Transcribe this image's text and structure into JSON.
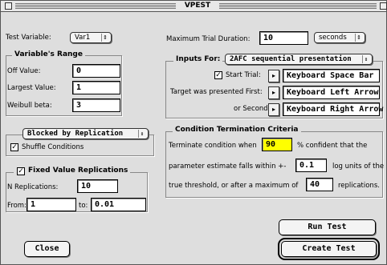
{
  "window": {
    "title": "VPEST"
  },
  "test_variable": {
    "label": "Test Variable:",
    "value": "Var1"
  },
  "variable_range": {
    "title": "Variable's Range",
    "off_value_label": "Off Value:",
    "off_value": "0",
    "largest_value_label": "Largest Value:",
    "largest_value": "1",
    "weibull_label": "Weibull beta:",
    "weibull_value": "3"
  },
  "blocking": {
    "popup_value": "Blocked by Replication",
    "shuffle_label": "Shuffle Conditions",
    "shuffle_checked": true
  },
  "fixed_value": {
    "title": "Fixed Value Replications",
    "checked": true,
    "n_label": "N Replications:",
    "n_value": "10",
    "from_label": "From:",
    "from_value": "1",
    "to_label": "to:",
    "to_value": "0.01"
  },
  "max_duration": {
    "label": "Maximum Trial Duration:",
    "value": "10",
    "unit": "seconds"
  },
  "inputs": {
    "title": "Inputs For:",
    "mode": "2AFC sequential presentation",
    "start_trial_label": "Start Trial:",
    "start_trial_checked": true,
    "start_trial_key": "Keyboard Space Bar",
    "target_first_label": "Target was presented First:",
    "target_first_key": "Keyboard Left Arrow",
    "second_label": "or Second:",
    "second_key": "Keyboard Right Arrow"
  },
  "termination": {
    "title": "Condition Termination Criteria",
    "line1_prefix": "Terminate condition when",
    "confidence": "90",
    "line1_suffix": "% confident that the",
    "line2_prefix": "parameter estimate falls within +-",
    "log_units": "0.1",
    "line2_suffix": "log units of the",
    "line3_prefix": "true threshold, or after a maximum of",
    "max_replications": "40",
    "line3_suffix": "replications."
  },
  "buttons": {
    "close": "Close",
    "run_test": "Run Test",
    "create_test": "Create Test"
  }
}
